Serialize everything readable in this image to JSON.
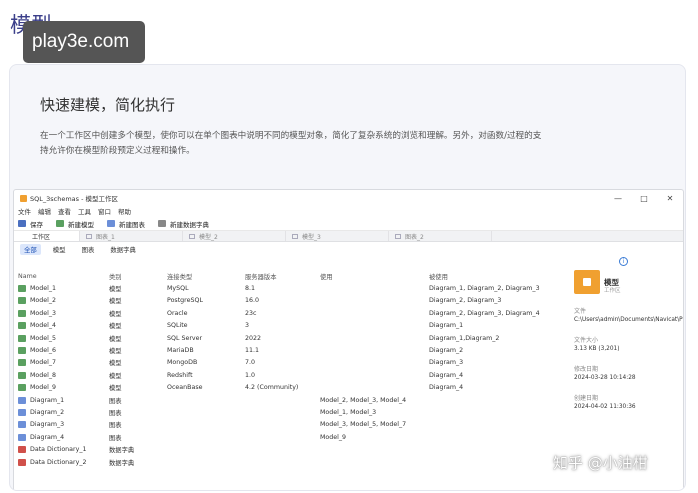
{
  "page": {
    "heading": "模型",
    "watermark_site": "play3e.com",
    "watermark_zhihu": "知乎 @小油柑"
  },
  "card": {
    "title": "快速建模，简化执行",
    "description": "在一个工作区中创建多个模型，使你可以在单个图表中说明不同的模型对象，简化了复杂系统的浏览和理解。另外，对函数/过程的支持允许你在模型阶段预定义过程和操作。"
  },
  "window": {
    "title": "SQL_3schemas - 模型工作区",
    "controls": {
      "minimize": "—",
      "maximize": "□",
      "close": "✕"
    },
    "menu": [
      "文件",
      "编辑",
      "查看",
      "工具",
      "窗口",
      "帮助"
    ],
    "toolbar": [
      {
        "label": "保存",
        "icon": "save-icon",
        "color": "#4a6fc0"
      },
      {
        "label": "新建模型",
        "icon": "new-model-icon",
        "color": "#5aa060"
      },
      {
        "label": "新建图表",
        "icon": "new-diagram-icon",
        "color": "#6c8fd8"
      },
      {
        "label": "新建数据字典",
        "icon": "new-dictionary-icon",
        "color": "#888"
      }
    ],
    "tabs": [
      "工作区",
      "图表_1",
      "模型_2",
      "模型_3",
      "图表_2"
    ],
    "subtabs": [
      "全部",
      "模型",
      "图表",
      "数据字典"
    ],
    "columns": [
      "Name",
      "类别",
      "连接类型",
      "服务器版本",
      "使用",
      "被使用"
    ],
    "rows": [
      {
        "name": "Model_1",
        "kind": "model",
        "cat": "模型",
        "conn": "MySQL",
        "ver": "8.1",
        "uses": "",
        "used": "Diagram_1, Diagram_2, Diagram_3"
      },
      {
        "name": "Model_2",
        "kind": "model",
        "cat": "模型",
        "conn": "PostgreSQL",
        "ver": "16.0",
        "uses": "",
        "used": "Diagram_2, Diagram_3"
      },
      {
        "name": "Model_3",
        "kind": "model",
        "cat": "模型",
        "conn": "Oracle",
        "ver": "23c",
        "uses": "",
        "used": "Diagram_2, Diagram_3, Diagram_4"
      },
      {
        "name": "Model_4",
        "kind": "model",
        "cat": "模型",
        "conn": "SQLite",
        "ver": "3",
        "uses": "",
        "used": "Diagram_1"
      },
      {
        "name": "Model_5",
        "kind": "model",
        "cat": "模型",
        "conn": "SQL Server",
        "ver": "2022",
        "uses": "",
        "used": "Diagram_1,Diagram_2"
      },
      {
        "name": "Model_6",
        "kind": "model",
        "cat": "模型",
        "conn": "MariaDB",
        "ver": "11.1",
        "uses": "",
        "used": "Diagram_2"
      },
      {
        "name": "Model_7",
        "kind": "model",
        "cat": "模型",
        "conn": "MongoDB",
        "ver": "7.0",
        "uses": "",
        "used": "Diagram_3"
      },
      {
        "name": "Model_8",
        "kind": "model",
        "cat": "模型",
        "conn": "Redshift",
        "ver": "1.0",
        "uses": "",
        "used": "Diagram_4"
      },
      {
        "name": "Model_9",
        "kind": "model",
        "cat": "模型",
        "conn": "OceanBase",
        "ver": "4.2 (Community)",
        "uses": "",
        "used": "Diagram_4"
      },
      {
        "name": "Diagram_1",
        "kind": "diagram",
        "cat": "图表",
        "conn": "",
        "ver": "",
        "uses": "Model_2, Model_3, Model_4",
        "used": ""
      },
      {
        "name": "Diagram_2",
        "kind": "diagram",
        "cat": "图表",
        "conn": "",
        "ver": "",
        "uses": "Model_1, Model_3",
        "used": ""
      },
      {
        "name": "Diagram_3",
        "kind": "diagram",
        "cat": "图表",
        "conn": "",
        "ver": "",
        "uses": "Model_3, Model_5, Model_7",
        "used": ""
      },
      {
        "name": "Diagram_4",
        "kind": "diagram",
        "cat": "图表",
        "conn": "",
        "ver": "",
        "uses": "Model_9",
        "used": ""
      },
      {
        "name": "Data Dictionary_1",
        "kind": "dict",
        "cat": "数据字典",
        "conn": "",
        "ver": "",
        "uses": "",
        "used": ""
      },
      {
        "name": "Data Dictionary_2",
        "kind": "dict",
        "cat": "数据字典",
        "conn": "",
        "ver": "",
        "uses": "",
        "used": ""
      }
    ]
  },
  "details": {
    "name": "模型",
    "subtitle": "工作区",
    "file_label": "文件",
    "file_value": "C:\\Users\\admin\\Documents\\Navicat\\Prem",
    "size_label": "文件大小",
    "size_value": "3.13 KB (3,201)",
    "modified_label": "修改日期",
    "modified_value": "2024-03-28 10:14:28",
    "created_label": "创建日期",
    "created_value": "2024-04-02 11:30:36"
  }
}
